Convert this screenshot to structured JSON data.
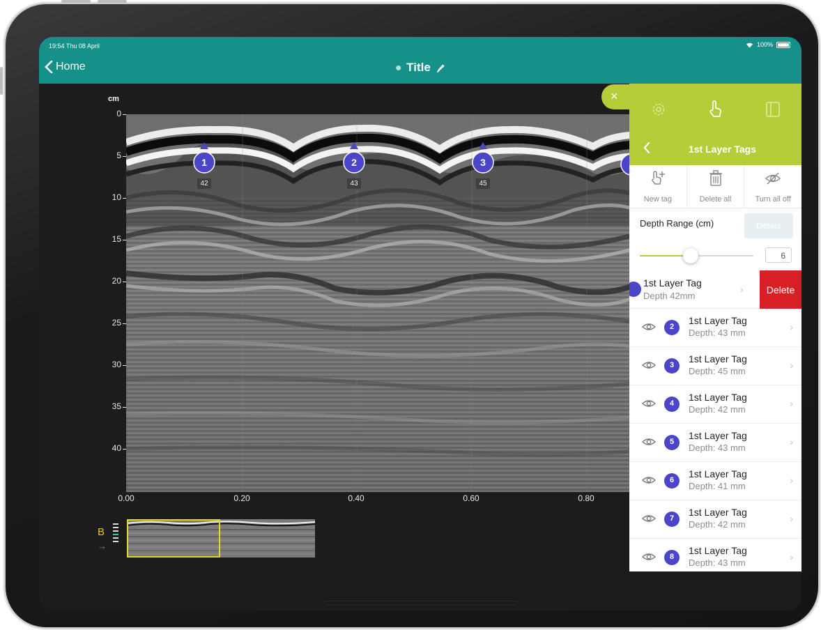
{
  "status_bar": {
    "time": "19:54 Thu 08 April",
    "battery": "100%"
  },
  "nav": {
    "back_label": "Home",
    "title": "Title"
  },
  "scan": {
    "y_unit": "cm",
    "y_ticks": [
      "0",
      "5",
      "10",
      "15",
      "20",
      "25",
      "30",
      "35",
      "40"
    ],
    "x_ticks": [
      "0.00",
      "0.20",
      "0.40",
      "0.60",
      "0.80"
    ],
    "markers": [
      {
        "number": "1",
        "depth": "42"
      },
      {
        "number": "2",
        "depth": "43"
      },
      {
        "number": "3",
        "depth": "45"
      }
    ],
    "minimap_label": "B"
  },
  "panel": {
    "close_symbol": "×",
    "header_title": "1st Layer Tags",
    "tools": {
      "new_tag": "New tag",
      "delete_all": "Delete all",
      "turn_all_off": "Turn all off"
    },
    "depth_range_label": "Depth Range (cm)",
    "detect_label": "Detect",
    "slider_value": "6",
    "slider_level": 0.45,
    "swiped_row": {
      "title": "1st Layer Tag",
      "subtitle": "Depth 42mm",
      "delete_label": "Delete"
    },
    "tags": [
      {
        "number": "2",
        "title": "1st Layer Tag",
        "subtitle": "Depth: 43 mm"
      },
      {
        "number": "3",
        "title": "1st Layer Tag",
        "subtitle": "Depth: 45 mm"
      },
      {
        "number": "4",
        "title": "1st Layer Tag",
        "subtitle": "Depth: 42 mm"
      },
      {
        "number": "5",
        "title": "1st Layer Tag",
        "subtitle": "Depth: 43 mm"
      },
      {
        "number": "6",
        "title": "1st Layer Tag",
        "subtitle": "Depth: 41 mm"
      },
      {
        "number": "7",
        "title": "1st Layer Tag",
        "subtitle": "Depth: 42 mm"
      },
      {
        "number": "8",
        "title": "1st Layer Tag",
        "subtitle": "Depth: 43 mm"
      }
    ]
  },
  "colors": {
    "teal": "#16918a",
    "lime": "#b6cc38",
    "marker": "#4b45c9",
    "delete": "#d91f26"
  }
}
